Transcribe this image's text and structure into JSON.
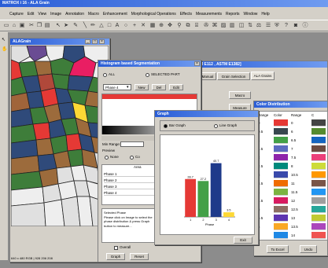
{
  "app": {
    "title": "MATROX i 16 - ALA Grain",
    "menu": [
      "Capture",
      "Edit",
      "View",
      "Image",
      "Annotation",
      "Macro",
      "Enhancement",
      "Morphological Operations",
      "Effects",
      "Measurements",
      "Reports",
      "Window",
      "Help"
    ]
  },
  "image_window": {
    "title": "ALAGrain",
    "status": "640 x 480 RGB | 928 206 208"
  },
  "main_window": {
    "title_suffix": "ies [ASTM E112 , ASTM E1382]",
    "tabs": [
      "Manual",
      "Grain Selection",
      "ALA Grains"
    ],
    "buttons": [
      "Macro",
      "Measure"
    ]
  },
  "histogram": {
    "title": "Histogram based Segmentation",
    "radio_all": "ALL",
    "radio_selected": "SELECTED PART",
    "phase_select": "Phase 4",
    "buttons": [
      "New",
      "Del",
      "Edit"
    ],
    "min_range_label": "Min Range:",
    "preview_label": "Preview",
    "preview_none": "None",
    "preview_con": "Co",
    "table_header": "Area",
    "phases": [
      "Phase 1",
      "Phase 2",
      "Phase 3",
      "Phase 4"
    ],
    "selected_phase_label": "Selected Phase",
    "instruction": "Please click on Image to select the phase distribution & press Graph button to measure...",
    "checkbox": "Overall",
    "bottom_buttons": [
      "Graph",
      "Reset"
    ]
  },
  "graph": {
    "title": "Graph",
    "radio_bar": "Bar Graph",
    "radio_line": "Line Graph",
    "exit": "Exit"
  },
  "color_distribution": {
    "title": "Color Distribution",
    "headers": [
      "Range",
      "Color",
      "Range",
      "C"
    ],
    "rows": [
      {
        "range": "0",
        "color": "#e53935",
        "range2": "0",
        "color2": "#444444"
      },
      {
        "range": "0.5",
        "color": "#37474f",
        "range2": "6",
        "color2": "#558b2f"
      },
      {
        "range": "1",
        "color": "#43a047",
        "range2": "6.5",
        "color2": "#1565c0"
      },
      {
        "range": "1.5",
        "color": "#5c6bc0",
        "range2": "7",
        "color2": "#6d4c41"
      },
      {
        "range": "2",
        "color": "#8e24aa",
        "range2": "7.5",
        "color2": "#ec407a"
      },
      {
        "range": "2.5",
        "color": "#00897b",
        "range2": "8",
        "color2": "#cddc39"
      },
      {
        "range": "3",
        "color": "#3949ab",
        "range2": "10.5",
        "color2": "#ff9800"
      },
      {
        "range": "3.5",
        "color": "#ef6c00",
        "range2": "11",
        "color2": "#795548"
      },
      {
        "range": "4",
        "color": "#7cb342",
        "range2": "11.5",
        "color2": "#2196f3"
      },
      {
        "range": "4.5",
        "color": "#d81b60",
        "range2": "12",
        "color2": "#9e9e9e"
      },
      {
        "range": "5",
        "color": "#8d6e63",
        "range2": "12.5",
        "color2": "#26a69a"
      },
      {
        "range": "5.5",
        "color": "#5e35b1",
        "range2": "13",
        "color2": "#c0ca33"
      },
      {
        "range": "6",
        "color": "#f9a825",
        "range2": "13.5",
        "color2": "#ab47bc"
      },
      {
        "range": "",
        "color": "#1e88e5",
        "range2": "14",
        "color2": "#ef5350"
      }
    ],
    "buttons": [
      "To Excel",
      "Undo"
    ]
  },
  "chart_data": {
    "type": "bar",
    "categories": [
      "1",
      "2",
      "3",
      "4"
    ],
    "values": [
      28.7,
      27.2,
      40.7,
      3.5
    ],
    "colors": [
      "#e53935",
      "#43a047",
      "#1e3a8a",
      "#fdd835"
    ],
    "xlabel": "Phase",
    "ylabel": "",
    "ylim": [
      0,
      50
    ]
  },
  "colors": {
    "title_blue": "#2a5dd6",
    "window_gray": "#d4d0c8"
  }
}
